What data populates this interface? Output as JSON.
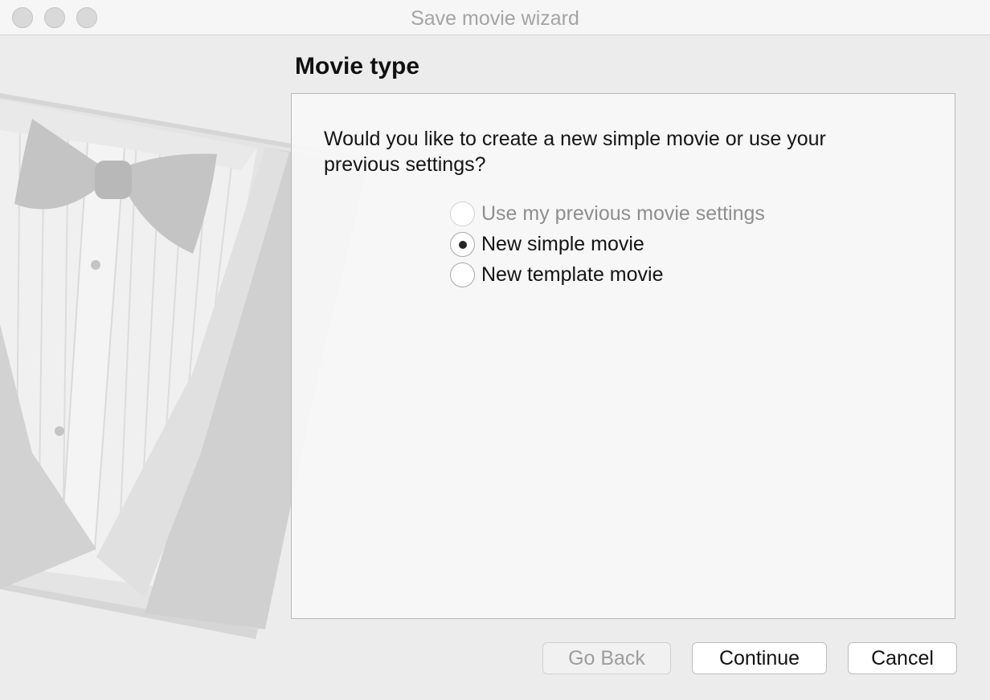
{
  "window": {
    "title": "Save movie wizard"
  },
  "page": {
    "title": "Movie type"
  },
  "question": "Would you like to create a new simple movie or use your previous settings?",
  "options": [
    {
      "label": "Use my previous movie settings",
      "enabled": false,
      "selected": false
    },
    {
      "label": "New simple movie",
      "enabled": true,
      "selected": true
    },
    {
      "label": "New template movie",
      "enabled": true,
      "selected": false
    }
  ],
  "buttons": {
    "back": "Go Back",
    "continue": "Continue",
    "cancel": "Cancel"
  }
}
